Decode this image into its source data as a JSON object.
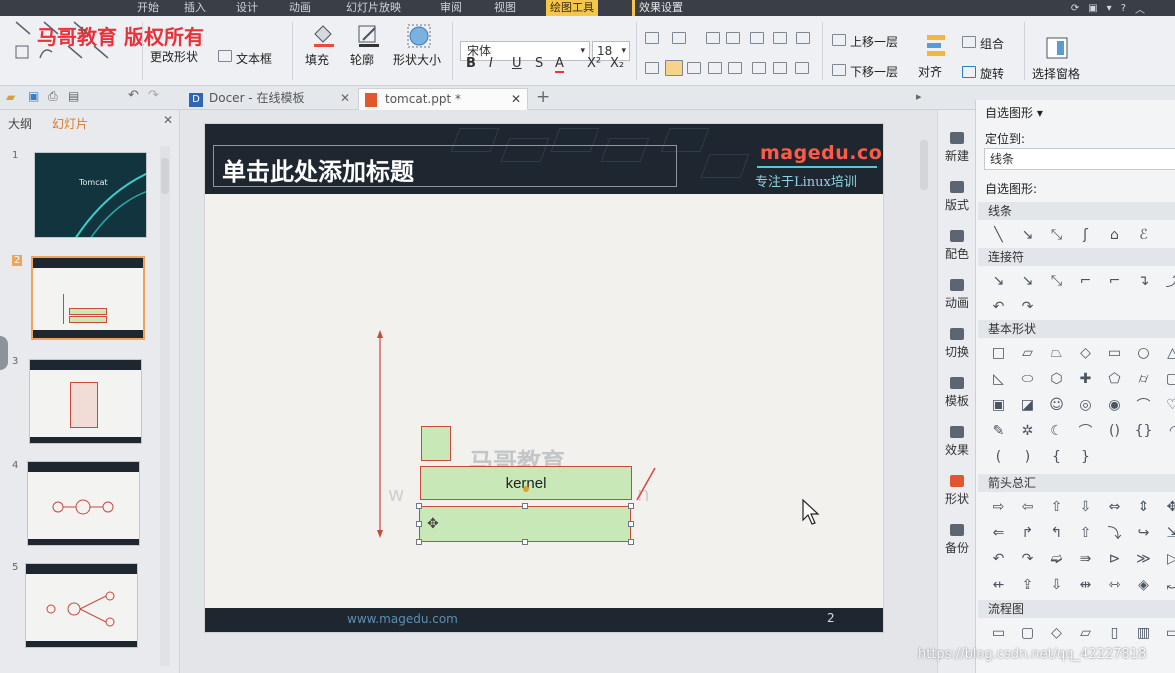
{
  "watermark": {
    "text": "马哥教育 版权所有"
  },
  "menubar": {
    "tabs": [
      "开始",
      "插入",
      "设计",
      "动画",
      "幻灯片放映",
      "审阅",
      "视图",
      "绘图工具",
      "效果设置"
    ],
    "active_tab": "绘图工具"
  },
  "ribbon": {
    "edit_shape": "更改形状",
    "text_box": "文本框",
    "fill": "填充",
    "outline": "轮廓",
    "shape_size": "形状大小",
    "font_name": "宋体",
    "font_size": "18",
    "bold": "B",
    "italic": "I",
    "underline": "U",
    "shadow": "S",
    "font_color": "A",
    "superscript": "X²",
    "subscript": "X₂",
    "bring_forward": "上移一层",
    "send_backward": "下移一层",
    "align": "对齐",
    "group": "组合",
    "rotate": "旋转",
    "selection_pane": "选择窗格"
  },
  "doc_tabs": [
    {
      "label": "Docer - 在线模板",
      "active": false
    },
    {
      "label": "tomcat.ppt *",
      "active": true
    }
  ],
  "left_panel": {
    "tabs": [
      "大纲",
      "幻灯片"
    ],
    "active_tab": "幻灯片",
    "slides": [
      {
        "num": "1",
        "label": "Tomcat"
      },
      {
        "num": "2",
        "label": ""
      },
      {
        "num": "3",
        "label": ""
      },
      {
        "num": "4",
        "label": ""
      },
      {
        "num": "5",
        "label": ""
      }
    ],
    "selected": 2
  },
  "slide": {
    "title_placeholder": "单击此处添加标题",
    "brand": "magedu.com",
    "brand_sub": "专注于Linux培训",
    "footer_url": "www.magedu.com",
    "slide_number": "2",
    "kernel_label": "kernel",
    "bg_watermark": "马哥教育",
    "bg_url_left": "w",
    "bg_url_right": "n"
  },
  "right_tools": [
    "新建",
    "版式",
    "配色",
    "动画",
    "切换",
    "模板",
    "效果",
    "形状",
    "备份"
  ],
  "right_tools_active": "形状",
  "pane": {
    "header": "自选图形 ▾",
    "position_label": "定位到:",
    "position_value": "线条",
    "autoshape_label": "自选图形:",
    "sections": [
      "线条",
      "连接符",
      "基本形状",
      "箭头总汇",
      "流程图"
    ],
    "lines": [
      "╲",
      "↘",
      "⤡",
      "ʃ",
      "⌂",
      "ℰ"
    ],
    "connectors": [
      "↘",
      "↘",
      "⤡",
      "⌐",
      "⌐",
      "↴",
      "⤴",
      "↶",
      "↷"
    ],
    "basic": [
      "□",
      "▱",
      "⏢",
      "◇",
      "▭",
      "○",
      "△",
      "◺",
      "⬭",
      "⬡",
      "✚",
      "⬠",
      "⌭",
      "▢",
      "▣",
      "◪",
      "☺",
      "◎",
      "◉",
      "⌒",
      "♡",
      "✎",
      "✲",
      "☾",
      "⌒",
      "()",
      "{}",
      "◜",
      "(",
      ")",
      "{",
      "}"
    ],
    "arrows": [
      "⇨",
      "⇦",
      "⇧",
      "⇩",
      "⇔",
      "⇕",
      "✥",
      "⇐",
      "↱",
      "↰",
      "⇧",
      "⤵",
      "↪",
      "⇲",
      "↶",
      "↷",
      "➫",
      "⇛",
      "⊳",
      "≫",
      "▷",
      "⇷",
      "⇪",
      "⇩",
      "⇹",
      "⇿",
      "◈",
      "⤾"
    ],
    "flowchart": [
      "▭",
      "▢",
      "◇",
      "▱",
      "▯",
      "▥",
      "▭"
    ]
  },
  "credit": "https://blog.csdn.net/qq_42227818"
}
